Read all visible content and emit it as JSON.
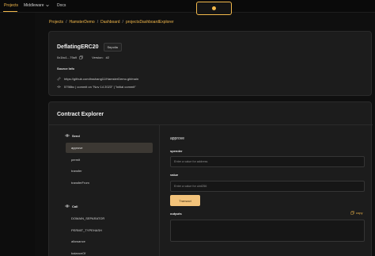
{
  "nav": {
    "projects": "Projects",
    "middleware": "Middleware",
    "docs": "Docs"
  },
  "breadcrumb": [
    "Projects",
    "HamsterDemo",
    "Dashboard",
    "projectsDashboardExplorer"
  ],
  "contract": {
    "name": "DeflatingERC20",
    "network": "Sepolia",
    "address": "0x1bc1...79a9",
    "version_label": "Version:",
    "version": "#2",
    "source_label": "Source Info",
    "repo": "https://github.com/bsshang11/HamsterDemo.git/main",
    "commit": "5798bc | commit on \"Nov 14 2023\" | \"initial commit\""
  },
  "explorer": {
    "title": "Contract Explorer",
    "send_label": "Send",
    "send_methods": [
      "approve",
      "permit",
      "transfer",
      "transferFrom"
    ],
    "call_label": "Call",
    "call_methods": [
      "DOMAIN_SEPARATOR",
      "PERMIT_TYPEHASH",
      "allowance",
      "balanceOf"
    ],
    "selected_method": "approve",
    "function_name": "approve",
    "params": [
      {
        "label": "spender",
        "placeholder": "Enter a value for address"
      },
      {
        "label": "value",
        "placeholder": "Enter a value for uint256"
      }
    ],
    "transact_label": "Transact",
    "outputs_label": "outputs",
    "copy_label": "copy"
  },
  "colors": {
    "accent": "#f2b84b",
    "button": "#f2c27a",
    "card": "#1c1c1c"
  }
}
